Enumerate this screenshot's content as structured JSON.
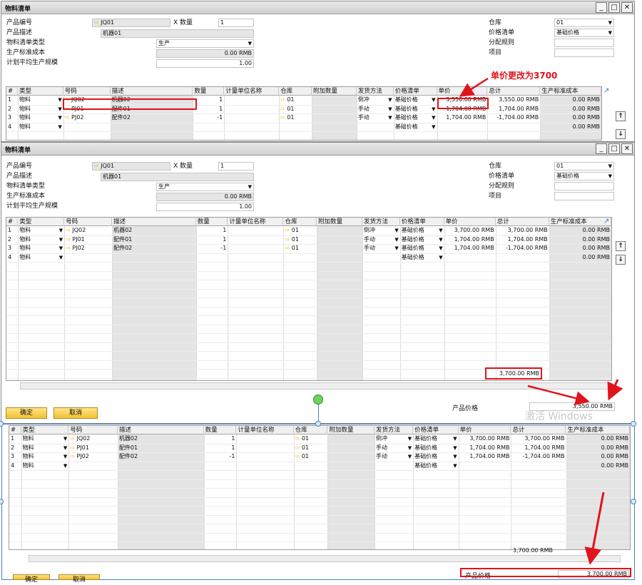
{
  "win1": {
    "title": "物料清单"
  },
  "win2": {
    "title": "物料清单"
  },
  "header": {
    "product_no_label": "产品编号",
    "product_no": "JQ01",
    "qty_label": "X 数量",
    "qty": "1",
    "product_desc_label": "产品描述",
    "product_desc": "机器01",
    "bom_type_label": "物料清单类型",
    "bom_type": "生产",
    "std_cost_label": "生产标准成本",
    "std_cost": "0.00 RMB",
    "plan_label": "计划平均生产规模",
    "plan": "1.00",
    "warehouse_label": "仓库",
    "warehouse": "01",
    "pricelist_label": "价格清单",
    "pricelist": "基础价格",
    "dist_label": "分配规则",
    "dist": "",
    "project_label": "项目",
    "project": ""
  },
  "columns": [
    "#",
    "类型",
    "号码",
    "描述",
    "数量",
    "计量单位名称",
    "仓库",
    "附加数量",
    "发货方法",
    "价格清单",
    "单价",
    "总计",
    "生产标准成本"
  ],
  "rows1": [
    {
      "n": "1",
      "type": "物料",
      "code": "JQ02",
      "desc": "机器02",
      "qty": "1",
      "wh": "01",
      "method": "倒冲",
      "pl": "基础价格",
      "price": "3,550.00 RMB",
      "total": "3,550.00 RMB",
      "std": "0.00 RMB"
    },
    {
      "n": "2",
      "type": "物料",
      "code": "PJ01",
      "desc": "配件01",
      "qty": "1",
      "wh": "01",
      "method": "手动",
      "pl": "基础价格",
      "price": "1,704.00 RMB",
      "total": "1,704.00 RMB",
      "std": "0.00 RMB"
    },
    {
      "n": "3",
      "type": "物料",
      "code": "PJ02",
      "desc": "配件02",
      "qty": "-1",
      "wh": "01",
      "method": "手动",
      "pl": "基础价格",
      "price": "1,704.00 RMB",
      "total": "-1,704.00 RMB",
      "std": "0.00 RMB"
    },
    {
      "n": "4",
      "type": "物料",
      "code": "",
      "desc": "",
      "qty": "",
      "wh": "",
      "method": "",
      "pl": "基础价格",
      "price": "",
      "total": "",
      "std": "0.00 RMB"
    }
  ],
  "rows2": [
    {
      "n": "1",
      "type": "物料",
      "code": "JQ02",
      "desc": "机器02",
      "qty": "1",
      "wh": "01",
      "method": "倒冲",
      "pl": "基础价格",
      "price": "3,700.00 RMB",
      "total": "3,700.00 RMB",
      "std": "0.00 RMB"
    },
    {
      "n": "2",
      "type": "物料",
      "code": "PJ01",
      "desc": "配件01",
      "qty": "1",
      "wh": "01",
      "method": "手动",
      "pl": "基础价格",
      "price": "1,704.00 RMB",
      "total": "1,704.00 RMB",
      "std": "0.00 RMB"
    },
    {
      "n": "3",
      "type": "物料",
      "code": "PJ02",
      "desc": "配件02",
      "qty": "-1",
      "wh": "01",
      "method": "手动",
      "pl": "基础价格",
      "price": "1,704.00 RMB",
      "total": "-1,704.00 RMB",
      "std": "0.00 RMB"
    },
    {
      "n": "4",
      "type": "物料",
      "code": "",
      "desc": "",
      "qty": "",
      "wh": "",
      "method": "",
      "pl": "基础价格",
      "price": "",
      "total": "",
      "std": "0.00 RMB"
    }
  ],
  "annotation": "单价更改为3700",
  "sum_total": "3,700.00 RMB",
  "product_price_label": "产品价格",
  "product_price_old": "3,550.00 RMB",
  "product_price_new": "3,700.00 RMB",
  "ok_label": "确定",
  "cancel_label": "取消",
  "watermark": "激活 Windows",
  "colors": {
    "highlight": "#e0141c",
    "button": "#f2c230"
  }
}
